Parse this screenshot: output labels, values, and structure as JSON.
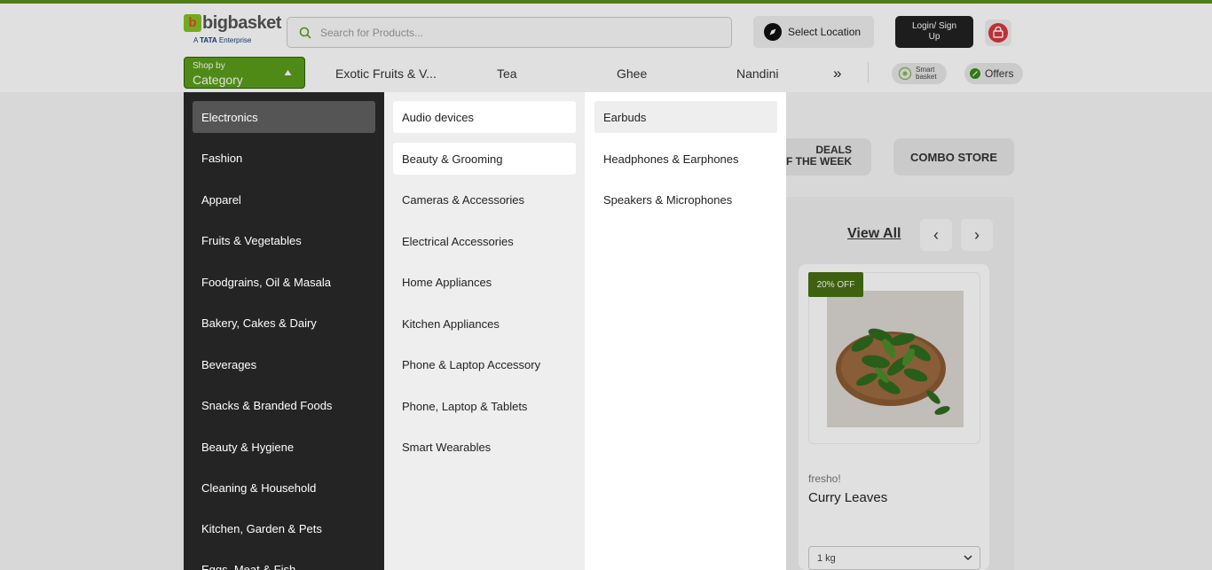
{
  "header": {
    "logo_text": "bigbasket",
    "logo_sub_prefix": "A",
    "logo_sub_brand": "TATA",
    "logo_sub_suffix": "Enterprise",
    "search_placeholder": "Search for Products...",
    "location_label": "Select Location",
    "login_label": "Login/ Sign Up",
    "category_small": "Shop by",
    "category_big": "Category",
    "nav_links": [
      "Exotic Fruits & V...",
      "Tea",
      "Ghee",
      "Nandini"
    ],
    "more_symbol": "»",
    "smart_basket_line1": "Smart",
    "smart_basket_line2": "basket",
    "offers_label": "Offers",
    "accent_color": "#5c9e1a"
  },
  "background": {
    "deals_line1": "DEALS",
    "deals_line2": "F THE WEEK",
    "combo_label": "COMBO STORE",
    "view_all": "View All",
    "prev_symbol": "‹",
    "next_symbol": "›",
    "card": {
      "badge": "20% OFF",
      "brand": "fresho!",
      "name": "Curry Leaves",
      "size": "1 kg"
    }
  },
  "menu": {
    "categories": [
      "Electronics",
      "Fashion",
      "Apparel",
      "Fruits & Vegetables",
      "Foodgrains, Oil & Masala",
      "Bakery, Cakes & Dairy",
      "Beverages",
      "Snacks & Branded Foods",
      "Beauty & Hygiene",
      "Cleaning & Household",
      "Kitchen, Garden & Pets",
      "Eggs, Meat & Fish"
    ],
    "subcategories": [
      "Audio devices",
      "Beauty & Grooming",
      "Cameras & Accessories",
      "Electrical Accessories",
      "Home Appliances",
      "Kitchen Appliances",
      "Phone & Laptop Accessory",
      "Phone, Laptop & Tablets",
      "Smart Wearables"
    ],
    "items": [
      "Earbuds",
      "Headphones & Earphones",
      "Speakers & Microphones"
    ]
  }
}
